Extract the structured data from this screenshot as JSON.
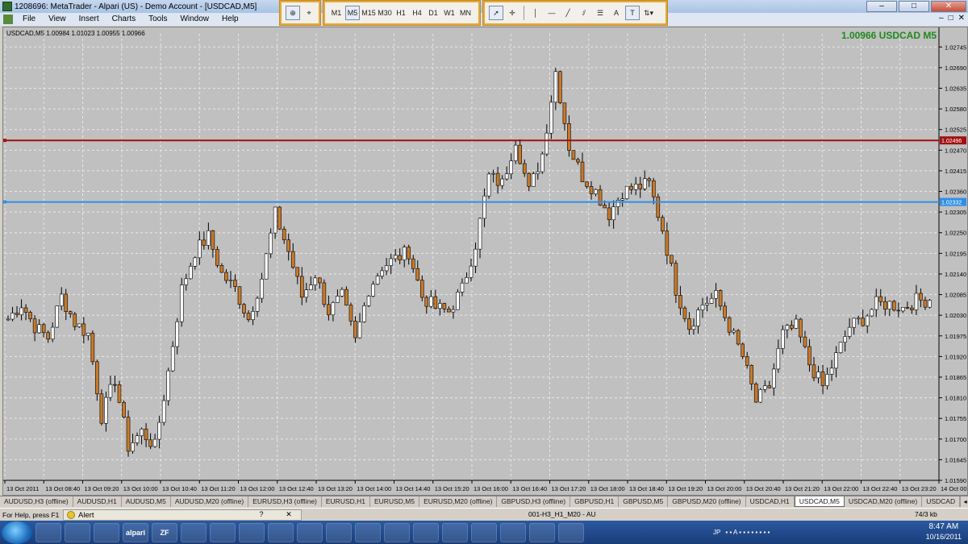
{
  "window": {
    "title": "1208696: MetaTrader - Alpari (US) - Demo Account - [USDCAD,M5]",
    "min_label": "–",
    "max_label": "□",
    "close_label": "✕"
  },
  "menu": {
    "items": [
      "File",
      "View",
      "Insert",
      "Charts",
      "Tools",
      "Window",
      "Help"
    ],
    "mdi": [
      "–",
      "□",
      "✕"
    ]
  },
  "timeframes": [
    "M1",
    "M5",
    "M15",
    "M30",
    "H1",
    "H4",
    "D1",
    "W1",
    "MN"
  ],
  "active_timeframe": "M5",
  "line_studies_tools": [
    "A",
    "T"
  ],
  "chart": {
    "symbol_info": "USDCAD,M5  1.00984 1.01023 1.00955 1.00966",
    "price_label": "1.00966 USDCAD M5",
    "colors": {
      "background": "#c0c0c0",
      "grid": "#e8e8e8",
      "bull_body": "#ffffff",
      "bear_body": "#c97a2a",
      "wick": "#000000",
      "red_line": "#a01010",
      "blue_line": "#2f8fe8",
      "price_text_green": "#1d8a1d"
    }
  },
  "chart_data": {
    "type": "candlestick",
    "title": "USDCAD,M5",
    "ylim": [
      1.0159,
      1.0278
    ],
    "y_ticks": [
      "1.02745",
      "1.02690",
      "1.02635",
      "1.02580",
      "1.02525",
      "1.02470",
      "1.02415",
      "1.02360",
      "1.02305",
      "1.02250",
      "1.02195",
      "1.02140",
      "1.02085",
      "1.02030",
      "1.01975",
      "1.01920",
      "1.01865",
      "1.01810",
      "1.01755",
      "1.01700",
      "1.01645",
      "1.01590"
    ],
    "x_ticks": [
      "13 Oct 2011",
      "13 Oct 08:40",
      "13 Oct 09:20",
      "13 Oct 10:00",
      "13 Oct 10:40",
      "13 Oct 11:20",
      "13 Oct 12:00",
      "13 Oct 12:40",
      "13 Oct 13:20",
      "13 Oct 14:00",
      "13 Oct 14:40",
      "13 Oct 15:20",
      "13 Oct 16:00",
      "13 Oct 16:40",
      "13 Oct 17:20",
      "13 Oct 18:00",
      "13 Oct 18:40",
      "13 Oct 19:20",
      "13 Oct 20:00",
      "13 Oct 20:40",
      "13 Oct 21:20",
      "13 Oct 22:00",
      "13 Oct 22:40",
      "13 Oct 23:20",
      "14 Oct 00:00"
    ],
    "horizontal_lines": [
      {
        "label": "1.02496",
        "value": 1.02496,
        "color": "#a01010"
      },
      {
        "label": "1.02332",
        "value": 1.02332,
        "color": "#2f8fe8"
      }
    ],
    "last_price": 1.00966,
    "anchors": [
      {
        "c": 1.0202
      },
      {
        "c": 1.0206
      },
      {
        "c": 1.02
      },
      {
        "c": 1.0197
      },
      {
        "c": 1.0208
      },
      {
        "c": 1.0201
      },
      {
        "c": 1.0198
      },
      {
        "c": 1.0176
      },
      {
        "c": 1.0186
      },
      {
        "c": 1.0168
      },
      {
        "c": 1.0172
      },
      {
        "c": 1.0168
      },
      {
        "c": 1.0188
      },
      {
        "c": 1.021
      },
      {
        "c": 1.022
      },
      {
        "c": 1.0224
      },
      {
        "c": 1.0214
      },
      {
        "c": 1.021
      },
      {
        "c": 1.0202
      },
      {
        "c": 1.0213
      },
      {
        "c": 1.023
      },
      {
        "c": 1.022
      },
      {
        "c": 1.0208
      },
      {
        "c": 1.0214
      },
      {
        "c": 1.0204
      },
      {
        "c": 1.0208
      },
      {
        "c": 1.0196
      },
      {
        "c": 1.021
      },
      {
        "c": 1.0216
      },
      {
        "c": 1.0218
      },
      {
        "c": 1.022
      },
      {
        "c": 1.0208
      },
      {
        "c": 1.0205
      },
      {
        "c": 1.0204
      },
      {
        "c": 1.021
      },
      {
        "c": 1.0222
      },
      {
        "c": 1.024
      },
      {
        "c": 1.0238
      },
      {
        "c": 1.025
      },
      {
        "c": 1.0236
      },
      {
        "c": 1.0246
      },
      {
        "c": 1.0268
      },
      {
        "c": 1.0248
      },
      {
        "c": 1.024
      },
      {
        "c": 1.0236
      },
      {
        "c": 1.023
      },
      {
        "c": 1.0236
      },
      {
        "c": 1.0237
      },
      {
        "c": 1.0238
      },
      {
        "c": 1.0226
      },
      {
        "c": 1.021
      },
      {
        "c": 1.02
      },
      {
        "c": 1.0206
      },
      {
        "c": 1.0208
      },
      {
        "c": 1.02
      },
      {
        "c": 1.0192
      },
      {
        "c": 1.018
      },
      {
        "c": 1.0184
      },
      {
        "c": 1.0198
      },
      {
        "c": 1.02
      },
      {
        "c": 1.019
      },
      {
        "c": 1.0184
      },
      {
        "c": 1.0192
      },
      {
        "c": 1.02
      },
      {
        "c": 1.0202
      },
      {
        "c": 1.0206
      },
      {
        "c": 1.0206
      },
      {
        "c": 1.0205
      },
      {
        "c": 1.0207
      },
      {
        "c": 1.0207
      }
    ]
  },
  "tabs": [
    "AUDUSD,H3 (offline)",
    "AUDUSD,H1",
    "AUDUSD,M5",
    "AUDUSD,M20 (offline)",
    "EURUSD,H3 (offline)",
    "EURUSD,H1",
    "EURUSD,M5",
    "EURUSD,M20 (offline)",
    "GBPUSD,H3 (offline)",
    "GBPUSD,H1",
    "GBPUSD,M5",
    "GBPUSD,M20 (offline)",
    "USDCAD,H1",
    "USDCAD,M5",
    "USDCAD,M20 (offline)",
    "USDCAD"
  ],
  "active_tab": "USDCAD,M5",
  "status": {
    "help": "For Help, press F1",
    "alert": "Alert",
    "alert_help": "?",
    "alert_close": "✕",
    "profile": "001-H3_H1_M20 - AU",
    "traffic": "74/3 kb"
  },
  "taskbar": {
    "apps": [
      "",
      "",
      "",
      "alpari",
      "ZF",
      "",
      "",
      "",
      "",
      "",
      "",
      "",
      "",
      "",
      "",
      "",
      "",
      "",
      ""
    ],
    "tray_lang": "JP",
    "time": "8:47 AM",
    "date": "10/16/2011"
  }
}
